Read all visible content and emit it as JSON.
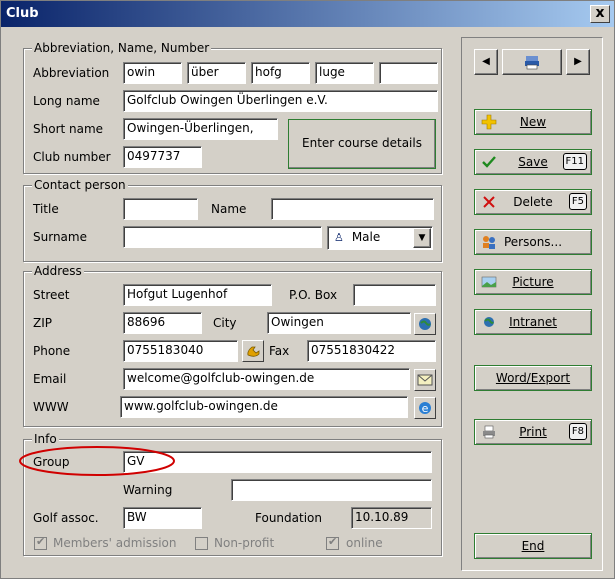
{
  "window": {
    "title": "Club",
    "close_glyph": "x"
  },
  "abbrev_group": {
    "legend": "Abbreviation, Name, Number",
    "abbrev_label": "Abbreviation",
    "abbrevs": [
      "owin",
      "über",
      "hofg",
      "luge",
      ""
    ],
    "longname_label": "Long name",
    "longname": "Golfclub Owingen Überlingen e.V.",
    "shortname_label": "Short name",
    "shortname": "Owingen-Überlingen,",
    "clubnum_label": "Club number",
    "clubnum": "0497737",
    "course_btn": "Enter course details"
  },
  "contact_group": {
    "legend": "Contact person",
    "title_label": "Title",
    "title_value": "",
    "name_label": "Name",
    "name_value": "",
    "surname_label": "Surname",
    "surname_value": "",
    "gender": "Male"
  },
  "address_group": {
    "legend": "Address",
    "street_label": "Street",
    "street": "Hofgut Lugenhof",
    "pobox_label": "P.O. Box",
    "pobox": "",
    "zip_label": "ZIP",
    "zip": "88696",
    "city_label": "City",
    "city": "Owingen",
    "phone_label": "Phone",
    "phone": "0755183040",
    "fax_label": "Fax",
    "fax": "07551830422",
    "email_label": "Email",
    "email": "welcome@golfclub-owingen.de",
    "www_label": "WWW",
    "www": "www.golfclub-owingen.de"
  },
  "info_group": {
    "legend": "Info",
    "group_label": "Group",
    "group_value": "GV",
    "warning_label": "Warning",
    "warning_value": "",
    "assoc_label": "Golf assoc.",
    "assoc_value": "BW",
    "foundation_label": "Foundation",
    "foundation_value": "10.10.89",
    "members_admission": "Members' admission",
    "nonprofit": "Non-profit",
    "online": "online"
  },
  "sidebar": {
    "new": "New",
    "save": "Save",
    "save_key": "F11",
    "delete": "Delete",
    "delete_key": "F5",
    "persons": "Persons...",
    "picture": "Picture",
    "intranet": "Intranet",
    "word_export": "Word/Export",
    "print": "Print",
    "print_key": "F8",
    "end": "End"
  },
  "colors": {
    "highlight_ellipse": "#d00000",
    "green_border": "#2e7d32",
    "title_bar": "#0a246a"
  }
}
